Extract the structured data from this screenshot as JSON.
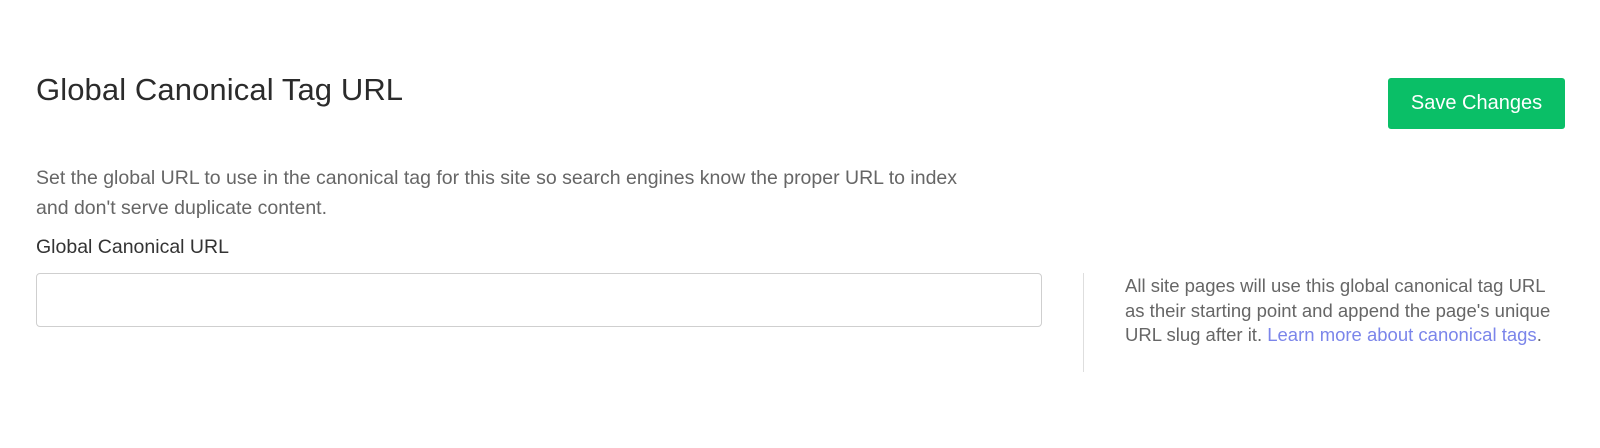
{
  "header": {
    "title": "Global Canonical Tag URL",
    "save_label": "Save Changes"
  },
  "description": "Set the global URL to use in the canonical tag for this site so search engines know the proper URL to index and don't serve duplicate content.",
  "field": {
    "label": "Global Canonical URL",
    "value": "",
    "placeholder": ""
  },
  "help": {
    "text": "All site pages will use this global canonical tag URL as their starting point and append the page's unique URL slug after it. ",
    "link_text": "Learn more about canonical tags",
    "suffix": "."
  },
  "colors": {
    "accent": "#0abf67",
    "link": "#7b85ea",
    "muted_text": "#666666"
  }
}
